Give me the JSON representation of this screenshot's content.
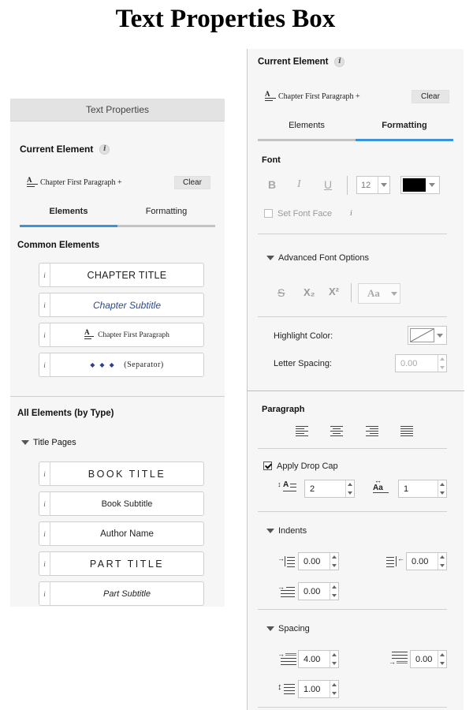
{
  "heading": "Text Properties Box",
  "left_panel": {
    "title": "Text Properties",
    "current_element_label": "Current Element",
    "info_glyph": "i",
    "current_element_value": "Chapter First Paragraph +",
    "clear_label": "Clear",
    "tabs": [
      {
        "label": "Elements",
        "active": true
      },
      {
        "label": "Formatting",
        "active": false
      }
    ],
    "common_elements_label": "Common Elements",
    "common_elements": [
      {
        "label": "CHAPTER TITLE"
      },
      {
        "label": "Chapter Subtitle"
      },
      {
        "label": "Chapter First Paragraph"
      },
      {
        "label": "(Separator)",
        "ornament": "◆ ◆ ◆"
      }
    ],
    "all_elements_label": "All Elements (by Type)",
    "group_label": "Title Pages",
    "title_page_elements": [
      {
        "label": "BOOK TITLE"
      },
      {
        "label": "Book Subtitle"
      },
      {
        "label": "Author Name"
      },
      {
        "label": "PART TITLE"
      },
      {
        "label": "Part Subtitle"
      }
    ]
  },
  "right_panel": {
    "current_element_label": "Current Element",
    "info_glyph": "i",
    "current_element_value": "Chapter First Paragraph +",
    "clear_label": "Clear",
    "tabs": [
      {
        "label": "Elements",
        "active": false
      },
      {
        "label": "Formatting",
        "active": true
      }
    ],
    "font": {
      "section_label": "Font",
      "bold_glyph": "B",
      "italic_glyph": "I",
      "underline_glyph": "U",
      "font_size": "12",
      "font_color": "#000000",
      "set_font_face_label": "Set Font Face",
      "set_font_face_checked": false,
      "info_glyph": "i",
      "advanced_label": "Advanced Font Options",
      "strike_glyph": "S",
      "subscript_glyph": "X₂",
      "superscript_glyph": "X²",
      "case_glyph": "Aa",
      "highlight_label": "Highlight Color:",
      "letter_spacing_label": "Letter Spacing:",
      "letter_spacing_value": "0.00"
    },
    "paragraph": {
      "section_label": "Paragraph",
      "alignments": [
        "left",
        "center",
        "right",
        "justify"
      ],
      "drop_cap_label": "Apply Drop Cap",
      "drop_cap_checked": true,
      "drop_cap_lines": "2",
      "drop_cap_chars": "1",
      "indents_label": "Indents",
      "indent_left": "0.00",
      "indent_right": "0.00",
      "indent_first": "0.00",
      "spacing_label": "Spacing",
      "space_before": "4.00",
      "space_after": "0.00",
      "line_spacing": "1.00"
    }
  },
  "colors": {
    "accent": "#3b93d9",
    "panel_bg": "#f6f6f6",
    "separator_blue": "#2e3f8f"
  }
}
